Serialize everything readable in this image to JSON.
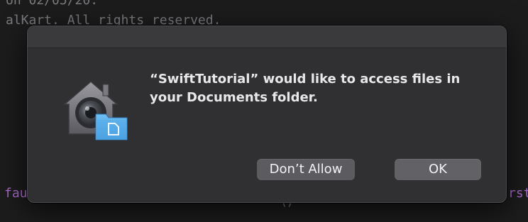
{
  "background": {
    "code_top_1": "on 02/05/20.",
    "code_top_2": "alKart. All rights reserved.",
    "code_bottom_left": "fau",
    "code_bottom_mid": "()",
    "code_bottom_right": "rst"
  },
  "dialog": {
    "message": "“SwiftTutorial” would like to access files in your Documents folder.",
    "icon": "privacy-folder-icon",
    "buttons": {
      "dont_allow": "Don’t Allow",
      "ok": "OK"
    }
  },
  "colors": {
    "dialog_bg": "#303033",
    "button_bg": "#5c5c60",
    "text": "#e8e8ea",
    "folder_blue": "#4aa3e8"
  }
}
